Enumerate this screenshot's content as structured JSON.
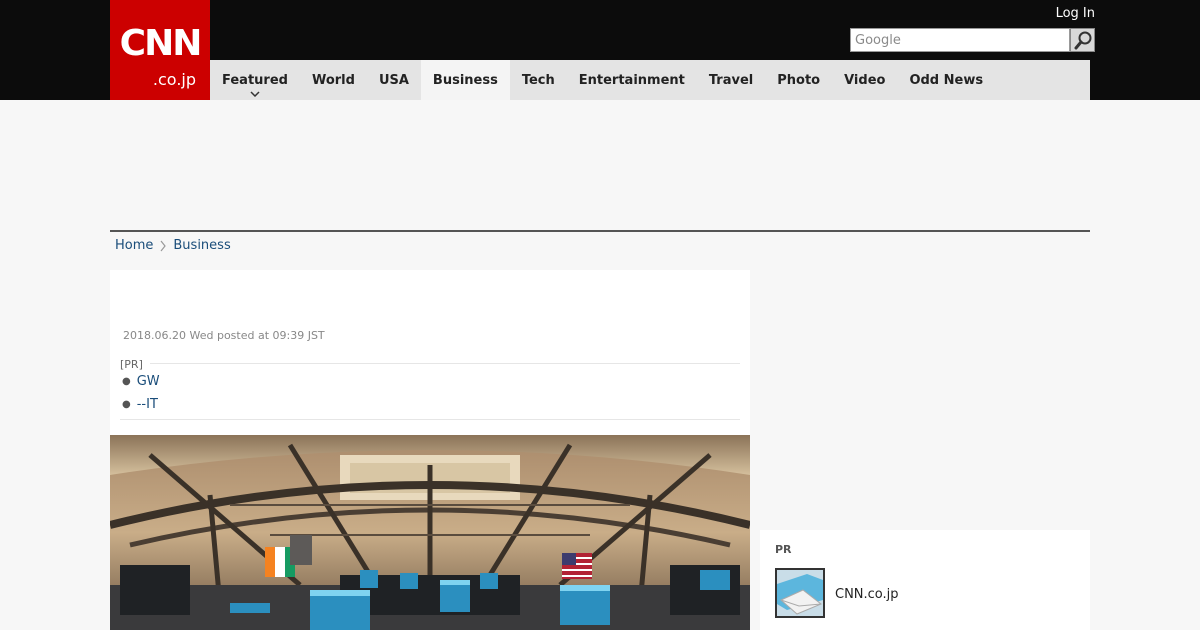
{
  "header": {
    "logo_main": "CNN",
    "logo_sub": ".co.jp",
    "login_label": "Log In",
    "search_placeholder": "Google",
    "search_icon": "magnifier-icon"
  },
  "nav": {
    "items": [
      {
        "label": "Featured"
      },
      {
        "label": "World"
      },
      {
        "label": "USA"
      },
      {
        "label": "Business"
      },
      {
        "label": "Tech"
      },
      {
        "label": "Entertainment"
      },
      {
        "label": "Travel"
      },
      {
        "label": "Photo"
      },
      {
        "label": "Video"
      },
      {
        "label": "Odd News"
      }
    ],
    "active": "Business"
  },
  "breadcrumb": {
    "home": "Home",
    "section": "Business"
  },
  "article": {
    "date": "2018.06.20 Wed posted at 09:39 JST",
    "pr_label": "[PR]",
    "pr_links": [
      "GW",
      "--IT"
    ]
  },
  "sidebar": {
    "title": "PR",
    "item_label": "CNN.co.jp"
  },
  "colors": {
    "brand_red": "#cc0000",
    "topbar": "#0c0c0c",
    "link": "#1a4d7a"
  }
}
